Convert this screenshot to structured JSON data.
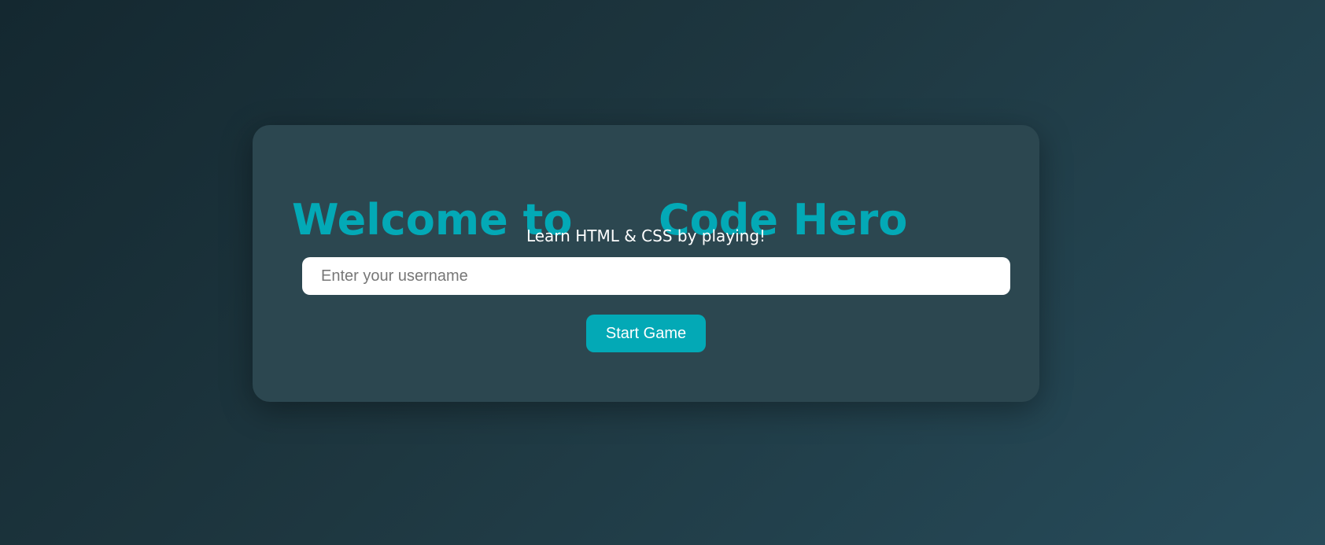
{
  "welcome": {
    "title_part1": "Welcome to",
    "title_part2": "Code Hero",
    "subtitle": "Learn HTML & CSS by playing!",
    "username_placeholder": "Enter your username",
    "username_value": "",
    "start_button_label": "Start Game"
  },
  "colors": {
    "accent": "#03a9b6",
    "card_background": "#2c4750",
    "page_background_start": "#142830",
    "page_background_end": "#274c5b",
    "text_light": "#ffffff"
  }
}
